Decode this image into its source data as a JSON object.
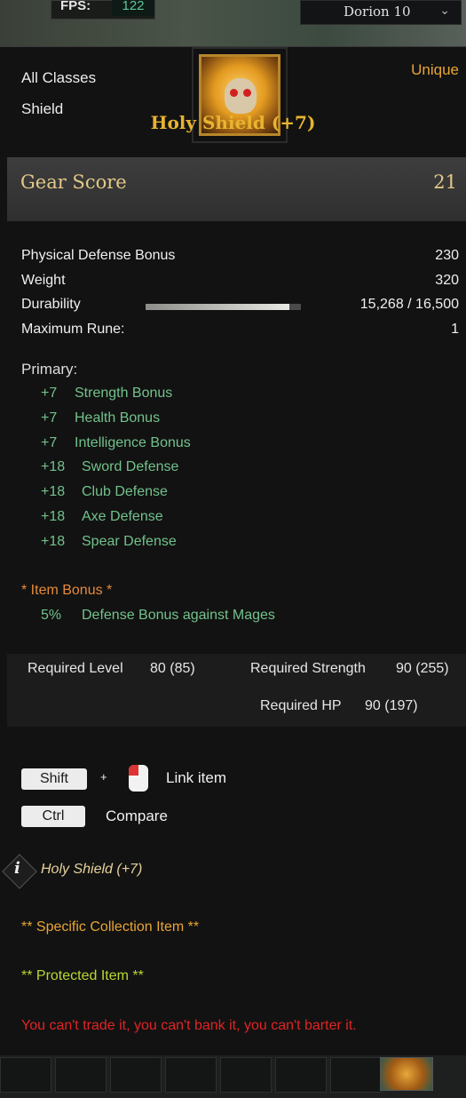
{
  "hud": {
    "fps_label": "FPS:",
    "fps_value": "122",
    "server": "Dorion 10"
  },
  "item": {
    "class": "All Classes",
    "type": "Shield",
    "grade": "Unique",
    "name": "Holy Shield (+7)",
    "gear_score_label": "Gear Score",
    "gear_score": "21"
  },
  "stats": {
    "physical_defense_label": "Physical Defense Bonus",
    "physical_defense": "230",
    "weight_label": "Weight",
    "weight": "320",
    "durability_label": "Durability",
    "durability": "15,268 / 16,500",
    "durability_fraction": 0.925,
    "max_rune_label": "Maximum Rune:",
    "max_rune": "1"
  },
  "primary": {
    "heading": "Primary:",
    "items": [
      {
        "value": "+7",
        "label": "Strength Bonus"
      },
      {
        "value": "+7",
        "label": "Health Bonus"
      },
      {
        "value": "+7",
        "label": "Intelligence Bonus"
      },
      {
        "value": "+18",
        "label": "Sword Defense"
      },
      {
        "value": "+18",
        "label": "Club Defense"
      },
      {
        "value": "+18",
        "label": "Axe Defense"
      },
      {
        "value": "+18",
        "label": "Spear Defense"
      }
    ]
  },
  "item_bonus": {
    "heading": "*  Item Bonus *",
    "value": "5%",
    "label": "Defense Bonus against Mages"
  },
  "requirements": {
    "level_label": "Required Level",
    "level": "80 (85)",
    "strength_label": "Required Strength",
    "strength": "90 (255)",
    "hp_label": "Required HP",
    "hp": "90 (197)"
  },
  "controls": {
    "shift_key": "Shift",
    "plus": "+",
    "link_label": "Link item",
    "ctrl_key": "Ctrl",
    "compare_label": "Compare"
  },
  "info": {
    "glyph": "i",
    "text": "Holy Shield (+7)"
  },
  "notes": {
    "collection": "** Specific Collection Item **",
    "protected": "** Protected Item **",
    "restriction": "You can't trade it, you can't bank it, you can't barter it."
  },
  "colors": {
    "title": "#e8b430",
    "grade": "#e8a536",
    "stat_green": "#72c28c",
    "bonus_orange": "#e68a3a",
    "collection": "#e8a536",
    "protected": "#b8d832",
    "restriction": "#e02424"
  }
}
